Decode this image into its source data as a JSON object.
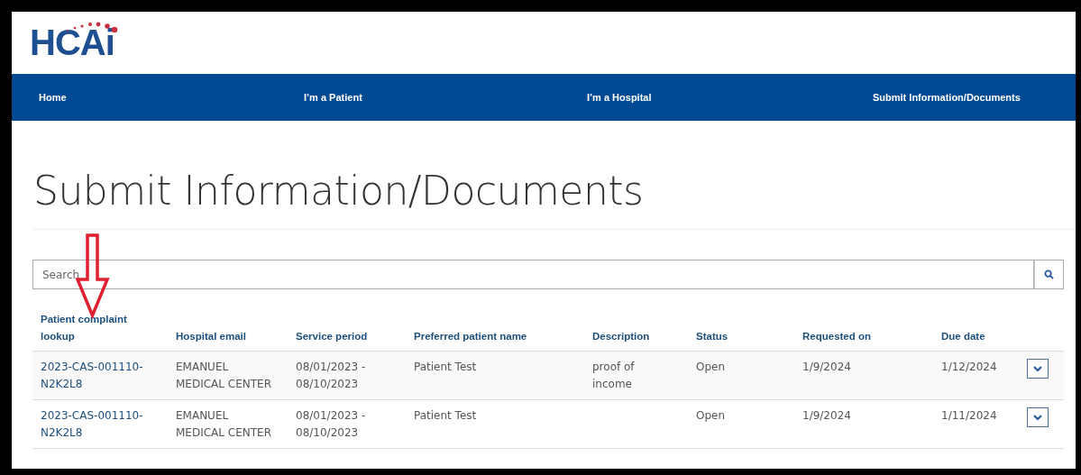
{
  "logo": "HCAi",
  "nav": [
    "Home",
    "I’m a Patient",
    "I’m a Hospital",
    "Submit Information/Documents"
  ],
  "title": "Submit Information/Documents",
  "search": {
    "placeholder": "Search"
  },
  "table": {
    "columns": [
      "Patient complaint lookup",
      "Hospital email",
      "Service period",
      "Preferred patient name",
      "Description",
      "Status",
      "Requested on",
      "Due date"
    ],
    "rows": [
      {
        "lookup": "2023-CAS-001110-N2K2L8",
        "hospital": "EMANUEL MEDICAL CENTER",
        "period": "08/01/2023 - 08/10/2023",
        "name": "Patient Test",
        "description": "proof of income",
        "status": "Open",
        "requested": "1/9/2024",
        "due": "1/12/2024"
      },
      {
        "lookup": "2023-CAS-001110-N2K2L8",
        "hospital": "EMANUEL MEDICAL CENTER",
        "period": "08/01/2023 - 08/10/2023",
        "name": "Patient Test",
        "status": "Open",
        "requested": "1/9/2024",
        "due": "1/11/2024"
      }
    ]
  }
}
